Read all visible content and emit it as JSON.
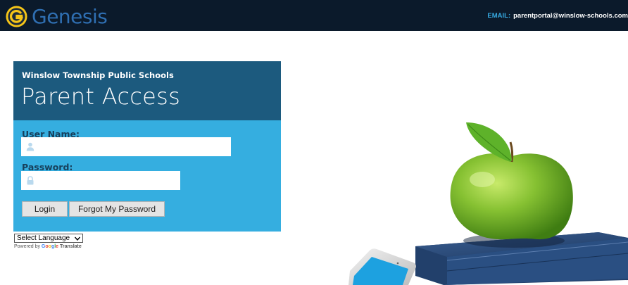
{
  "header": {
    "brand": "Genesis",
    "email_label": "EMAIL:",
    "email": "parentportal@winslow-schools.com",
    "bg_color": "#0b1a2b",
    "brand_color": "#2f6fb2",
    "logo_color": "#f5c518"
  },
  "login": {
    "school": "Winslow Township Public Schools",
    "title": "Parent Access",
    "username_label": "User Name:",
    "username_value": "",
    "password_label": "Password:",
    "password_value": "",
    "login_button": "Login",
    "forgot_button": "Forgot My Password",
    "user_icon": "user-icon",
    "lock_icon": "lock-icon",
    "head_color": "#1c5a7e",
    "body_color": "#35aee0"
  },
  "translate": {
    "selected_language": "Select Language",
    "powered_by": "Powered by",
    "google": "Google",
    "translate": "Translate"
  }
}
